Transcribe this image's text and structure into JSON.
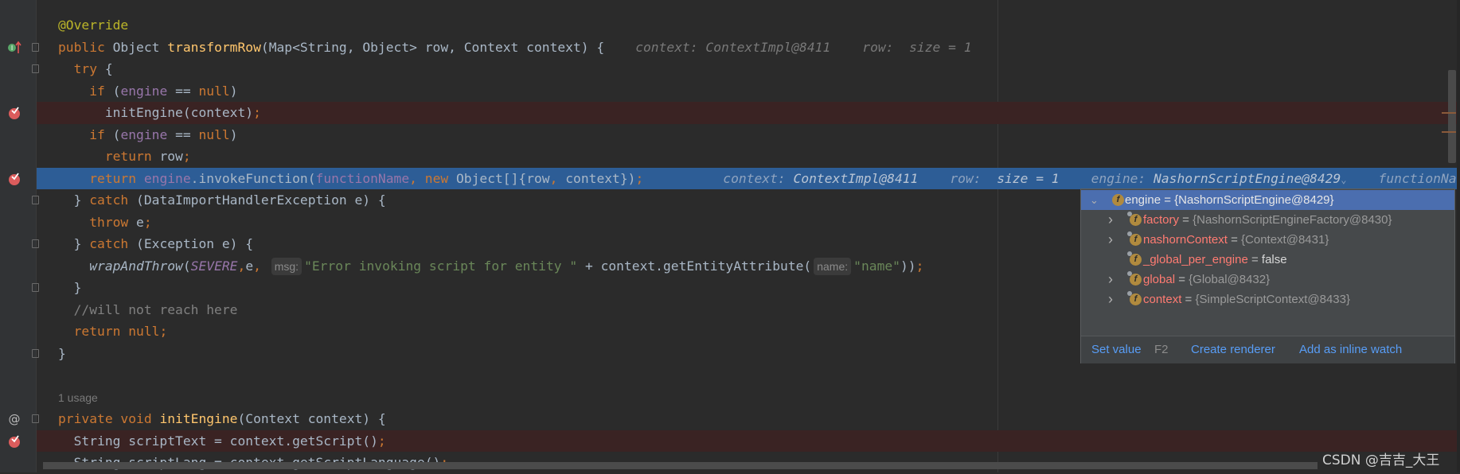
{
  "editor": {
    "lines": [
      {
        "tokens": [
          [
            "ann",
            "@Override"
          ]
        ]
      },
      {
        "gutter": "override",
        "tokens": [
          [
            "kw",
            "public "
          ],
          [
            "",
            "Object "
          ],
          [
            "fn",
            "transformRow"
          ],
          [
            "",
            "(Map<String, Object> row, Context context) {"
          ]
        ],
        "hints": [
          {
            "label": "context: ",
            "value": "ContextImpl@8411"
          },
          {
            "label": "row:  ",
            "value": "size = 1"
          }
        ],
        "hintGap": 39
      },
      {
        "tokens": [
          [
            "",
            "  "
          ],
          [
            "kw",
            "try "
          ],
          [
            "",
            "{"
          ]
        ]
      },
      {
        "tokens": [
          [
            "",
            "    "
          ],
          [
            "kw",
            "if "
          ],
          [
            "",
            "("
          ],
          [
            "fld",
            "engine"
          ],
          [
            "",
            " == "
          ],
          [
            "kw",
            "null"
          ],
          [
            "",
            ")"
          ]
        ]
      },
      {
        "gutter": "breakpoint",
        "style": "bp",
        "tokens": [
          [
            "",
            "      initEngine(context)"
          ],
          [
            "semi",
            ";"
          ]
        ]
      },
      {
        "tokens": [
          [
            "",
            "    "
          ],
          [
            "kw",
            "if "
          ],
          [
            "",
            "("
          ],
          [
            "fld",
            "engine"
          ],
          [
            "",
            " == "
          ],
          [
            "kw",
            "null"
          ],
          [
            "",
            ")"
          ]
        ]
      },
      {
        "tokens": [
          [
            "",
            "      "
          ],
          [
            "kw",
            "return "
          ],
          [
            "",
            "row"
          ],
          [
            "semi",
            ";"
          ]
        ]
      },
      {
        "gutter": "breakpoint",
        "style": "cur",
        "tokens": [
          [
            "",
            "    "
          ],
          [
            "kw",
            "return "
          ],
          [
            "fld",
            "engine"
          ],
          [
            "",
            ".invokeFunction("
          ],
          [
            "fld",
            "functionName"
          ],
          [
            "kw",
            ", new "
          ],
          [
            "",
            "Object[]{row"
          ],
          [
            "kw",
            ", "
          ],
          [
            "",
            "context})"
          ],
          [
            "semi",
            ";"
          ]
        ],
        "hints": [
          {
            "label": "context: ",
            "value": "ContextImpl@8411"
          },
          {
            "label": "row:  ",
            "value": "size = 1"
          },
          {
            "label": "engine: ",
            "value": "NashornScriptEngine@8429",
            "dropdown": "⌄"
          },
          {
            "label": "functionNa",
            "value": ""
          }
        ],
        "hintGap": 100
      },
      {
        "tokens": [
          [
            "",
            "  } "
          ],
          [
            "kw",
            "catch "
          ],
          [
            "",
            "(DataImportHandlerException e) {"
          ]
        ]
      },
      {
        "tokens": [
          [
            "",
            "    "
          ],
          [
            "kw",
            "throw "
          ],
          [
            "",
            "e"
          ],
          [
            "semi",
            ";"
          ]
        ]
      },
      {
        "tokens": [
          [
            "",
            "  } "
          ],
          [
            "kw",
            "catch "
          ],
          [
            "",
            "(Exception e) {"
          ]
        ]
      },
      {
        "tokens": [
          [
            "",
            "    "
          ],
          [
            "it",
            "wrapAndThrow"
          ],
          [
            "",
            "("
          ],
          [
            "static",
            "SEVERE"
          ],
          [
            "kw",
            ","
          ],
          [
            "",
            "e"
          ],
          [
            "kw",
            ", "
          ],
          [
            "ph",
            "msg:"
          ],
          [
            "str",
            "\"Error invoking script for entity \""
          ],
          [
            "",
            " + context.getEntityAttribute("
          ],
          [
            "ph",
            "name:"
          ],
          [
            "str",
            "\"name\""
          ],
          [
            "",
            "))"
          ],
          [
            "semi",
            ";"
          ]
        ]
      },
      {
        "tokens": [
          [
            "",
            "  }"
          ]
        ]
      },
      {
        "tokens": [
          [
            "",
            "  "
          ],
          [
            "cmt",
            "//will not reach here"
          ]
        ]
      },
      {
        "tokens": [
          [
            "",
            "  "
          ],
          [
            "kw",
            "return null"
          ],
          [
            "semi",
            ";"
          ]
        ]
      },
      {
        "tokens": [
          [
            "",
            "}"
          ]
        ]
      },
      {
        "tokens": []
      },
      {
        "tokens": [
          [
            "usage",
            "1 usage"
          ]
        ]
      },
      {
        "gutter": "implements",
        "tokens": [
          [
            "kw",
            "private void "
          ],
          [
            "fn",
            "initEngine"
          ],
          [
            "",
            "(Context context) {"
          ]
        ]
      },
      {
        "gutter": "breakpoint",
        "style": "bp",
        "tokens": [
          [
            "",
            "  String scriptText = context.getScript()"
          ],
          [
            "semi",
            ";"
          ]
        ]
      },
      {
        "tokens": [
          [
            "",
            "  String scriptLang = context.getScriptLanguage()"
          ],
          [
            "semi",
            ";"
          ]
        ]
      }
    ]
  },
  "popup": {
    "root": {
      "name": "engine",
      "eq": " = ",
      "value": "{NashornScriptEngine@8429}",
      "expanded": true
    },
    "children": [
      {
        "name": "factory",
        "eq": " = ",
        "value": "{NashornScriptEngineFactory@8430}",
        "expandable": true
      },
      {
        "name": "nashornContext",
        "eq": " = ",
        "value": "{Context@8431}",
        "expandable": true
      },
      {
        "name": "_global_per_engine",
        "eq": " = ",
        "value": "false",
        "expandable": false,
        "literal": true
      },
      {
        "name": "global",
        "eq": " = ",
        "value": "{Global@8432}",
        "expandable": true
      },
      {
        "name": "context",
        "eq": " = ",
        "value": "{SimpleScriptContext@8433}",
        "expandable": true
      }
    ],
    "footer": {
      "set_value": "Set value",
      "set_value_key": "F2",
      "create_renderer": "Create renderer",
      "add_inline_watch": "Add as inline watch"
    }
  },
  "watermark": "CSDN @吉吉_大王",
  "colors": {
    "keyword": "#cc7832",
    "annotation": "#bbb529",
    "method": "#ffc66d",
    "field": "#9876aa",
    "string": "#6a8759",
    "breakpoint_line": "#3a2323",
    "execution_line": "#2d5d96",
    "link": "#589df6"
  }
}
